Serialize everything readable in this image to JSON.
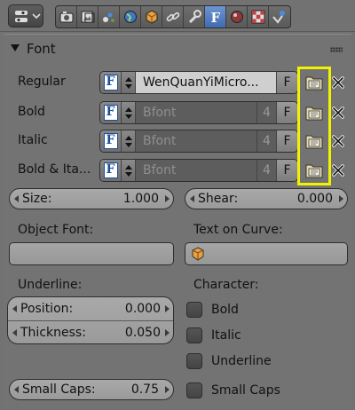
{
  "header": {
    "tabs": [
      "render-icon",
      "scene-icon",
      "world-icon",
      "world-globe-icon",
      "object-icon",
      "constraints-icon",
      "modifier-icon",
      "font-data-icon",
      "material-icon",
      "texture-icon",
      "physics-icon"
    ],
    "active_tab": "font-data-icon"
  },
  "panel": {
    "title": "Font"
  },
  "fonts": {
    "rows": [
      {
        "label": "Regular",
        "name": "WenQuanYiMicro...",
        "count": "",
        "fake_user": "F"
      },
      {
        "label": "Bold",
        "name": "Bfont",
        "count": "4",
        "fake_user": "F"
      },
      {
        "label": "Italic",
        "name": "Bfont",
        "count": "4",
        "fake_user": "F"
      },
      {
        "label": "Bold & Ita...",
        "name": "Bfont",
        "count": "4",
        "fake_user": "F"
      }
    ]
  },
  "transform": {
    "size_label": "Size:",
    "size_value": "1.000",
    "shear_label": "Shear:",
    "shear_value": "0.000"
  },
  "object_font": {
    "label": "Object Font:",
    "value": ""
  },
  "text_on_curve": {
    "label": "Text on Curve:",
    "value": ""
  },
  "underline": {
    "label": "Underline:",
    "position_label": "Position:",
    "position_value": "0.000",
    "thickness_label": "Thickness:",
    "thickness_value": "0.050"
  },
  "small_caps": {
    "label": "Small Caps:",
    "value": "0.75"
  },
  "character": {
    "label": "Character:",
    "options": [
      "Bold",
      "Italic",
      "Underline",
      "Small Caps"
    ]
  },
  "colors": {
    "highlight": "#f2f200",
    "active_tab": "#3f6bb0",
    "panel_bg": "#737373"
  }
}
